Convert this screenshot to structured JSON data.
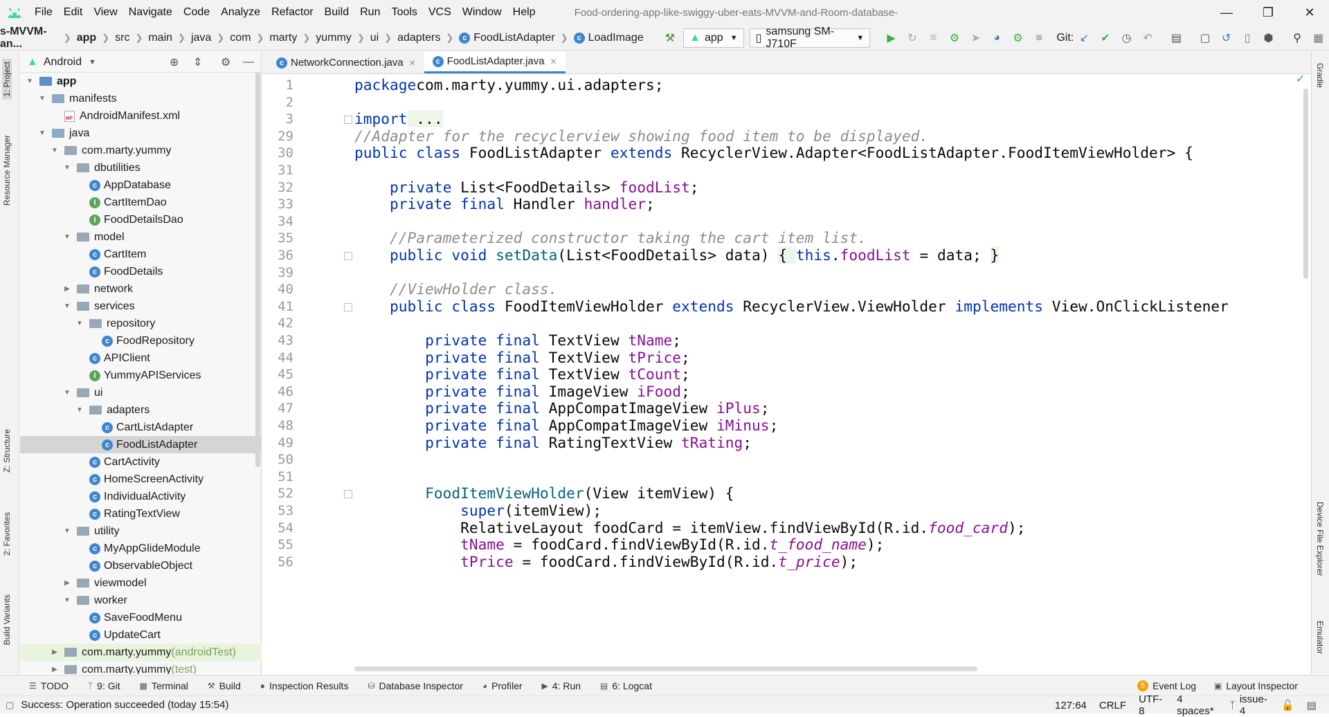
{
  "menubar": {
    "items": [
      "File",
      "Edit",
      "View",
      "Navigate",
      "Code",
      "Analyze",
      "Refactor",
      "Build",
      "Run",
      "Tools",
      "VCS",
      "Window",
      "Help"
    ],
    "window_title": "Food-ordering-app-like-swiggy-uber-eats-MVVM-and-Room-database-"
  },
  "navbar": {
    "crumbs": [
      "s-MVVM-an...",
      "app",
      "src",
      "main",
      "java",
      "com",
      "marty",
      "yummy",
      "ui",
      "adapters",
      "FoodListAdapter",
      "LoadImage"
    ],
    "run_config": "app",
    "device": "samsung SM-J710F",
    "git_label": "Git:"
  },
  "left_tabs": [
    "1: Project",
    "Resource Manager",
    "Z: Structure",
    "2: Favorites",
    "Build Variants"
  ],
  "right_tabs": [
    "Gradle",
    "Device File Explorer",
    "Emulator"
  ],
  "project_panel": {
    "view_mode": "Android",
    "tree": [
      {
        "label": "app",
        "kind": "module",
        "depth": 0,
        "expanded": true
      },
      {
        "label": "manifests",
        "kind": "folder",
        "depth": 1,
        "expanded": true
      },
      {
        "label": "AndroidManifest.xml",
        "kind": "manifest",
        "depth": 2
      },
      {
        "label": "java",
        "kind": "folder",
        "depth": 1,
        "expanded": true
      },
      {
        "label": "com.marty.yummy",
        "kind": "package",
        "depth": 2,
        "expanded": true
      },
      {
        "label": "dbutilities",
        "kind": "package",
        "depth": 3,
        "expanded": true
      },
      {
        "label": "AppDatabase",
        "kind": "class",
        "depth": 4
      },
      {
        "label": "CartItemDao",
        "kind": "interface",
        "depth": 4
      },
      {
        "label": "FoodDetailsDao",
        "kind": "interface",
        "depth": 4
      },
      {
        "label": "model",
        "kind": "package",
        "depth": 3,
        "expanded": true
      },
      {
        "label": "CartItem",
        "kind": "class",
        "depth": 4
      },
      {
        "label": "FoodDetails",
        "kind": "class",
        "depth": 4
      },
      {
        "label": "network",
        "kind": "package",
        "depth": 3,
        "expanded": false
      },
      {
        "label": "services",
        "kind": "package",
        "depth": 3,
        "expanded": true
      },
      {
        "label": "repository",
        "kind": "package",
        "depth": 4,
        "expanded": true
      },
      {
        "label": "FoodRepository",
        "kind": "class",
        "depth": 5
      },
      {
        "label": "APIClient",
        "kind": "class",
        "depth": 4
      },
      {
        "label": "YummyAPIServices",
        "kind": "interface",
        "depth": 4
      },
      {
        "label": "ui",
        "kind": "package",
        "depth": 3,
        "expanded": true
      },
      {
        "label": "adapters",
        "kind": "package",
        "depth": 4,
        "expanded": true
      },
      {
        "label": "CartListAdapter",
        "kind": "class",
        "depth": 5
      },
      {
        "label": "FoodListAdapter",
        "kind": "class",
        "depth": 5,
        "selected": true
      },
      {
        "label": "CartActivity",
        "kind": "class",
        "depth": 4
      },
      {
        "label": "HomeScreenActivity",
        "kind": "class",
        "depth": 4
      },
      {
        "label": "IndividualActivity",
        "kind": "class",
        "depth": 4
      },
      {
        "label": "RatingTextView",
        "kind": "class",
        "depth": 4
      },
      {
        "label": "utility",
        "kind": "package",
        "depth": 3,
        "expanded": true
      },
      {
        "label": "MyAppGlideModule",
        "kind": "class",
        "depth": 4
      },
      {
        "label": "ObservableObject",
        "kind": "class",
        "depth": 4
      },
      {
        "label": "viewmodel",
        "kind": "package",
        "depth": 3,
        "expanded": false
      },
      {
        "label": "worker",
        "kind": "package",
        "depth": 3,
        "expanded": true
      },
      {
        "label": "SaveFoodMenu",
        "kind": "class",
        "depth": 4
      },
      {
        "label": "UpdateCart",
        "kind": "class",
        "depth": 4
      },
      {
        "label": "com.marty.yummy",
        "suffix": "(androidTest)",
        "kind": "package",
        "depth": 2,
        "expanded": false,
        "test": true
      },
      {
        "label": "com.marty.yummy",
        "suffix": "(test)",
        "kind": "package",
        "depth": 2,
        "expanded": false
      }
    ]
  },
  "editor": {
    "tabs": [
      {
        "label": "NetworkConnection.java",
        "active": false
      },
      {
        "label": "FoodListAdapter.java",
        "active": true
      }
    ],
    "line_numbers": [
      "1",
      "2",
      "3",
      "29",
      "30",
      "31",
      "32",
      "33",
      "34",
      "35",
      "36",
      "39",
      "40",
      "41",
      "42",
      "43",
      "44",
      "45",
      "46",
      "47",
      "48",
      "49",
      "50",
      "51",
      "52",
      "53",
      "54",
      "55",
      "56"
    ],
    "lines": [
      [
        [
          "kw",
          "package"
        ],
        [
          "",
          "com.marty.yummy.ui.adapters;"
        ]
      ],
      [],
      [
        [
          "kw",
          "import"
        ],
        [
          "",
          ""
        ],
        [
          "fold",
          " ..."
        ]
      ],
      [
        [
          "cm",
          "//Adapter for the recyclerview showing food item to be displayed."
        ]
      ],
      [
        [
          "kw",
          "public class"
        ],
        [
          "",
          " FoodListAdapter "
        ],
        [
          "kw",
          "extends"
        ],
        [
          "",
          " RecyclerView.Adapter<FoodListAdapter.FoodItemViewHolder> {"
        ]
      ],
      [],
      [
        [
          "",
          "    "
        ],
        [
          "kw",
          "private"
        ],
        [
          "",
          " List<FoodDetails> "
        ],
        [
          "fld",
          "foodList"
        ],
        [
          "",
          ";"
        ]
      ],
      [
        [
          "",
          "    "
        ],
        [
          "kw",
          "private final"
        ],
        [
          "",
          " Handler "
        ],
        [
          "fld",
          "handler"
        ],
        [
          "",
          ";"
        ]
      ],
      [],
      [
        [
          "",
          "    "
        ],
        [
          "cm",
          "//Parameterized constructor taking the cart item list."
        ]
      ],
      [
        [
          "",
          "    "
        ],
        [
          "kw",
          "public void"
        ],
        [
          "",
          " "
        ],
        [
          "fn",
          "setData"
        ],
        [
          "",
          "(List<FoodDetails> data) "
        ],
        [
          "fold",
          "{ "
        ],
        [
          "kw",
          "this"
        ],
        [
          "",
          "."
        ],
        [
          "fld",
          "foodList"
        ],
        [
          "",
          " = data; "
        ],
        [
          "fold",
          "}"
        ]
      ],
      [],
      [
        [
          "",
          "    "
        ],
        [
          "cm",
          "//ViewHolder class."
        ]
      ],
      [
        [
          "",
          "    "
        ],
        [
          "kw",
          "public class"
        ],
        [
          "",
          " FoodItemViewHolder "
        ],
        [
          "kw",
          "extends"
        ],
        [
          "",
          " RecyclerView.ViewHolder "
        ],
        [
          "kw",
          "implements"
        ],
        [
          "",
          " View.OnClickListener"
        ]
      ],
      [],
      [
        [
          "",
          "        "
        ],
        [
          "kw",
          "private final"
        ],
        [
          "",
          " TextView "
        ],
        [
          "fld",
          "tName"
        ],
        [
          "",
          ";"
        ]
      ],
      [
        [
          "",
          "        "
        ],
        [
          "kw",
          "private final"
        ],
        [
          "",
          " TextView "
        ],
        [
          "fld",
          "tPrice"
        ],
        [
          "",
          ";"
        ]
      ],
      [
        [
          "",
          "        "
        ],
        [
          "kw",
          "private final"
        ],
        [
          "",
          " TextView "
        ],
        [
          "fld",
          "tCount"
        ],
        [
          "",
          ";"
        ]
      ],
      [
        [
          "",
          "        "
        ],
        [
          "kw",
          "private final"
        ],
        [
          "",
          " ImageView "
        ],
        [
          "fld",
          "iFood"
        ],
        [
          "",
          ";"
        ]
      ],
      [
        [
          "",
          "        "
        ],
        [
          "kw",
          "private final"
        ],
        [
          "",
          " AppCompatImageView "
        ],
        [
          "fld",
          "iPlus"
        ],
        [
          "",
          ";"
        ]
      ],
      [
        [
          "",
          "        "
        ],
        [
          "kw",
          "private final"
        ],
        [
          "",
          " AppCompatImageView "
        ],
        [
          "fld",
          "iMinus"
        ],
        [
          "",
          ";"
        ]
      ],
      [
        [
          "",
          "        "
        ],
        [
          "kw",
          "private final"
        ],
        [
          "",
          " RatingTextView "
        ],
        [
          "fld",
          "tRating"
        ],
        [
          "",
          ";"
        ]
      ],
      [],
      [],
      [
        [
          "",
          "        "
        ],
        [
          "fn",
          "FoodItemViewHolder"
        ],
        [
          "",
          "(View itemView) {"
        ]
      ],
      [
        [
          "",
          "            "
        ],
        [
          "kw",
          "super"
        ],
        [
          "",
          "(itemView);"
        ]
      ],
      [
        [
          "",
          "            RelativeLayout foodCard = itemView.findViewById(R.id."
        ],
        [
          "it",
          "food_card"
        ],
        [
          "",
          ");"
        ]
      ],
      [
        [
          "",
          "            "
        ],
        [
          "fld",
          "tName"
        ],
        [
          "",
          " = foodCard.findViewById(R.id."
        ],
        [
          "it",
          "t_food_name"
        ],
        [
          "",
          ");"
        ]
      ],
      [
        [
          "",
          "            "
        ],
        [
          "fld",
          "tPrice"
        ],
        [
          "",
          " = foodCard.findViewById(R.id."
        ],
        [
          "it",
          "t_price"
        ],
        [
          "",
          ");"
        ]
      ]
    ]
  },
  "bottom_tools": [
    {
      "label": "TODO",
      "icon": "list-icon"
    },
    {
      "label": "9: Git",
      "icon": "branch-icon"
    },
    {
      "label": "Terminal",
      "icon": "terminal-icon"
    },
    {
      "label": "Build",
      "icon": "hammer-icon"
    },
    {
      "label": "Inspection Results",
      "icon": "inspect-icon"
    },
    {
      "label": "Database Inspector",
      "icon": "database-icon"
    },
    {
      "label": "Profiler",
      "icon": "gauge-icon"
    },
    {
      "label": "4: Run",
      "icon": "play-icon"
    },
    {
      "label": "6: Logcat",
      "icon": "logcat-icon"
    }
  ],
  "bottom_right_tools": [
    {
      "label": "Event Log",
      "icon": "event-log-icon",
      "badge": "5"
    },
    {
      "label": "Layout Inspector",
      "icon": "layout-inspector-icon"
    }
  ],
  "status": {
    "message": "Success: Operation succeeded (today 15:54)",
    "position": "127:64",
    "line_sep": "CRLF",
    "encoding": "UTF-8",
    "indent": "4 spaces*",
    "branch": "issue-4"
  },
  "colors": {
    "keyword": "#0033b3",
    "comment": "#8c8c8c",
    "field": "#871094",
    "method": "#00627a",
    "accent": "#4083c9"
  }
}
